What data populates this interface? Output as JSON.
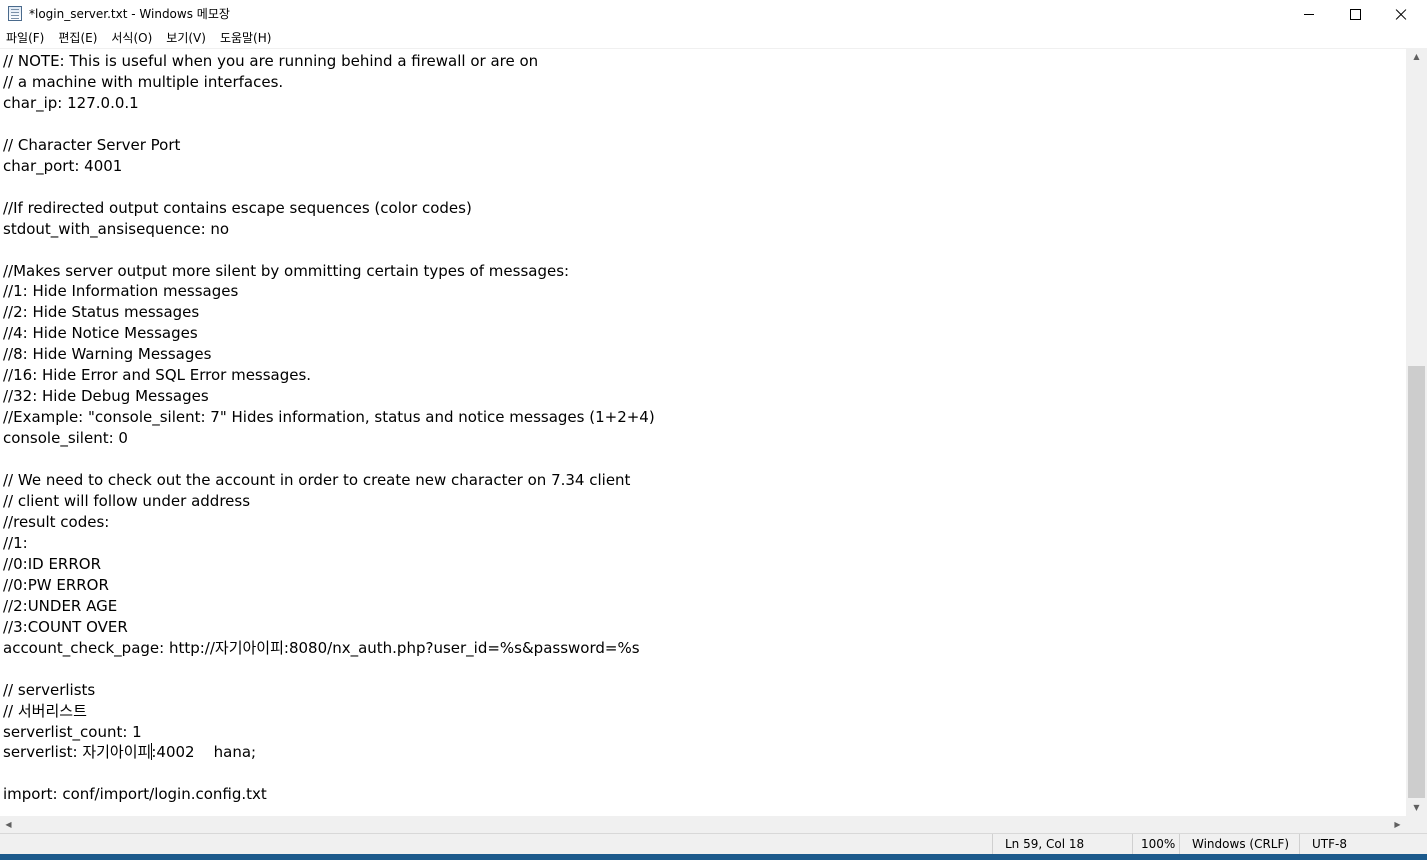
{
  "window": {
    "title": "*login_server.txt - Windows 메모장"
  },
  "menu": {
    "file": "파일(F)",
    "edit": "편집(E)",
    "format": "서식(O)",
    "view": "보기(V)",
    "help": "도움말(H)"
  },
  "editor": {
    "lines": [
      "// NOTE: This is useful when you are running behind a firewall or are on",
      "// a machine with multiple interfaces.",
      "char_ip: 127.0.0.1",
      "",
      "// Character Server Port",
      "char_port: 4001",
      "",
      "//If redirected output contains escape sequences (color codes)",
      "stdout_with_ansisequence: no",
      "",
      "//Makes server output more silent by ommitting certain types of messages:",
      "//1: Hide Information messages",
      "//2: Hide Status messages",
      "//4: Hide Notice Messages",
      "//8: Hide Warning Messages",
      "//16: Hide Error and SQL Error messages.",
      "//32: Hide Debug Messages",
      "//Example: \"console_silent: 7\" Hides information, status and notice messages (1+2+4)",
      "console_silent: 0",
      "",
      "// We need to check out the account in order to create new character on 7.34 client",
      "// client will follow under address",
      "//result codes:",
      "//1:",
      "//0:ID ERROR",
      "//0:PW ERROR",
      "//2:UNDER AGE",
      "//3:COUNT OVER",
      "account_check_page: http://자기아이피:8080/nx_auth.php?user_id=%s&password=%s",
      "",
      "// serverlists",
      "// 서버리스트",
      "serverlist_count: 1"
    ],
    "caret_line_before": "serverlist: 자기아이피",
    "caret_line_after": ":4002    hana;",
    "lines_after": [
      "",
      "import: conf/import/login.config.txt"
    ]
  },
  "status": {
    "position": "Ln 59, Col 18",
    "zoom": "100%",
    "line_ending": "Windows (CRLF)",
    "encoding": "UTF-8"
  },
  "icons": {
    "app": "notepad-icon",
    "minimize": "minimize-icon",
    "maximize": "maximize-icon",
    "close": "close-icon"
  }
}
